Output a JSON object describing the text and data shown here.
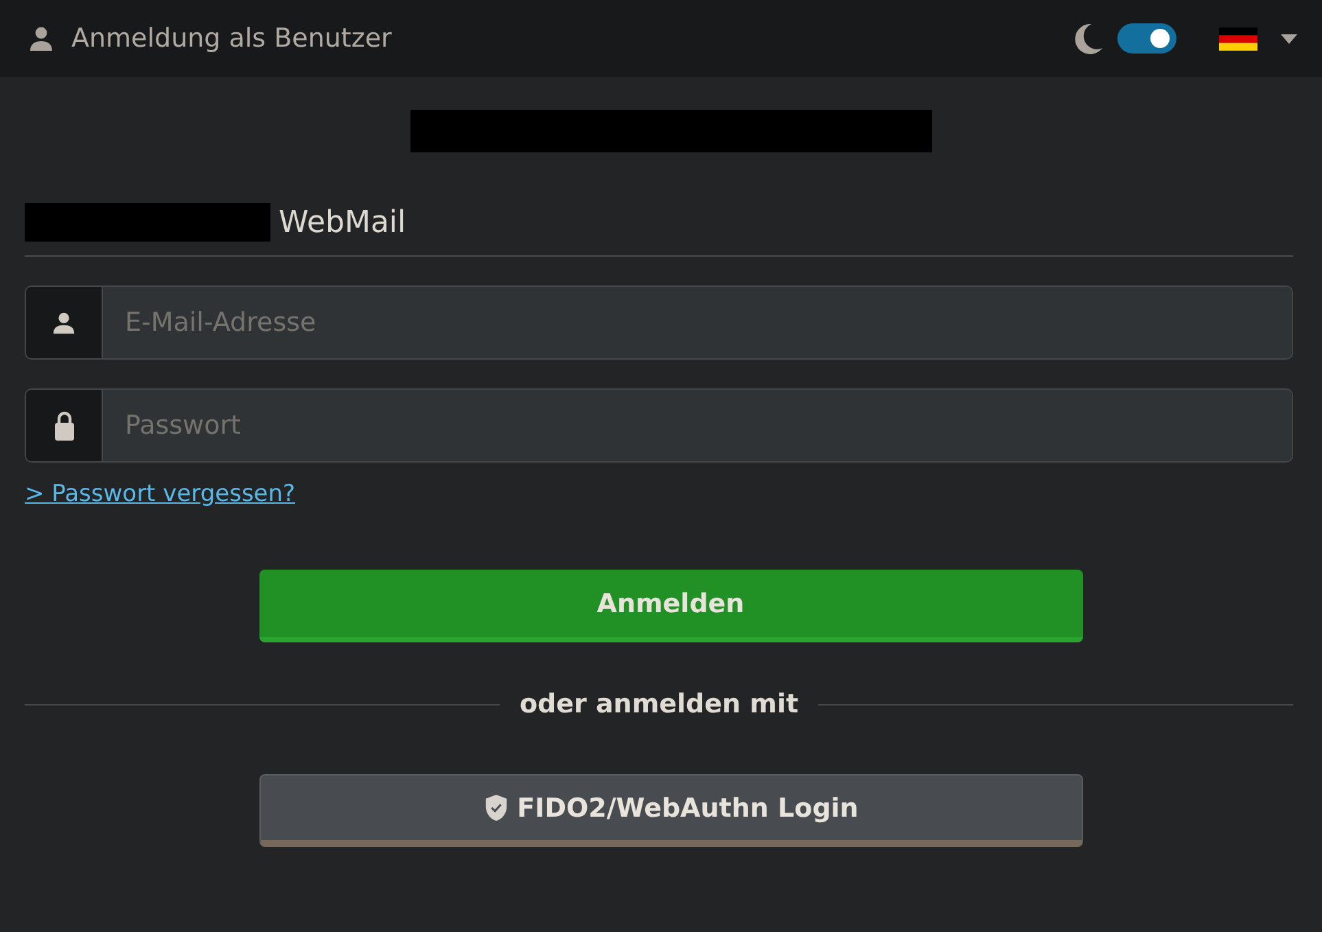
{
  "header": {
    "title": "Anmeldung als Benutzer",
    "dark_mode": {
      "on": true
    }
  },
  "app_name": "WebMail",
  "fields": [
    {
      "kind": "user",
      "placeholder": "E-Mail-Adresse"
    },
    {
      "kind": "lock",
      "placeholder": "Passwort"
    }
  ],
  "forgot_link": "> Passwort vergessen?",
  "login_button": "Anmelden",
  "separator": "oder anmelden mit",
  "fido_button": "FIDO2/WebAuthn Login"
}
